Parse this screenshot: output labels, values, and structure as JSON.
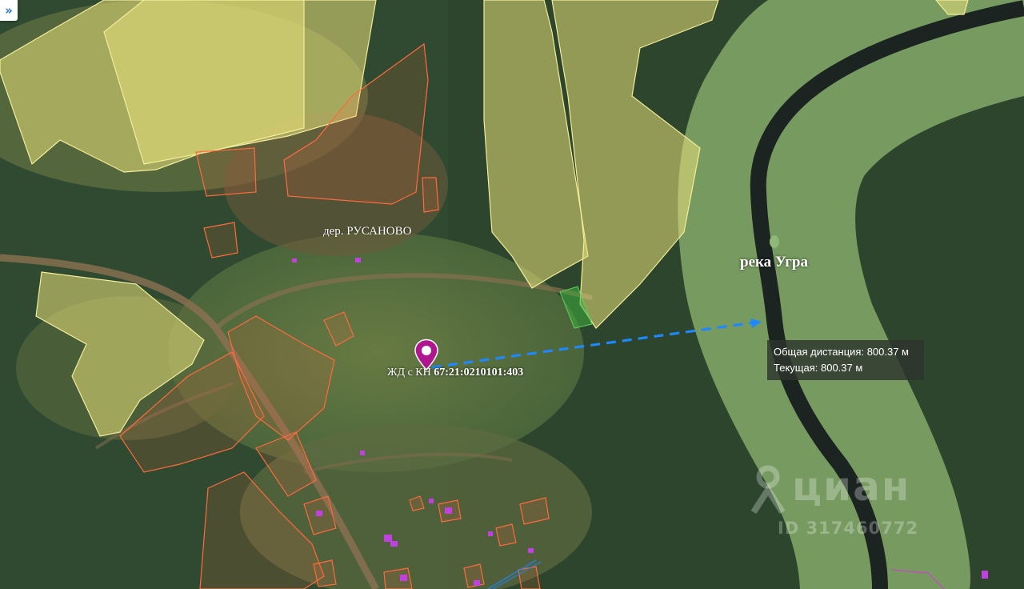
{
  "map": {
    "expand_button": {
      "glyph": "»",
      "icon": "double-chevron-right-icon"
    },
    "labels": {
      "village": "дер. РУСАНОВО",
      "river": "река Угра",
      "marker_prefix": "ЖД с КН ",
      "marker_cadastral": "67:21:0210101:403"
    },
    "measurement": {
      "total_label": "Общая дистанция:",
      "total_value": "800.37 м",
      "current_label": "Текущая:",
      "current_value": "800.37 м"
    },
    "watermark": {
      "brand": "циан",
      "id": "ID 317460772"
    },
    "colors": {
      "parcel_yellow": "#e8e07a",
      "parcel_orange": "#ff6a3d",
      "river_zone": "#b5e08a",
      "marker": "#b0178e",
      "measure_line": "#1e88ff",
      "building": "#c040e0"
    }
  }
}
